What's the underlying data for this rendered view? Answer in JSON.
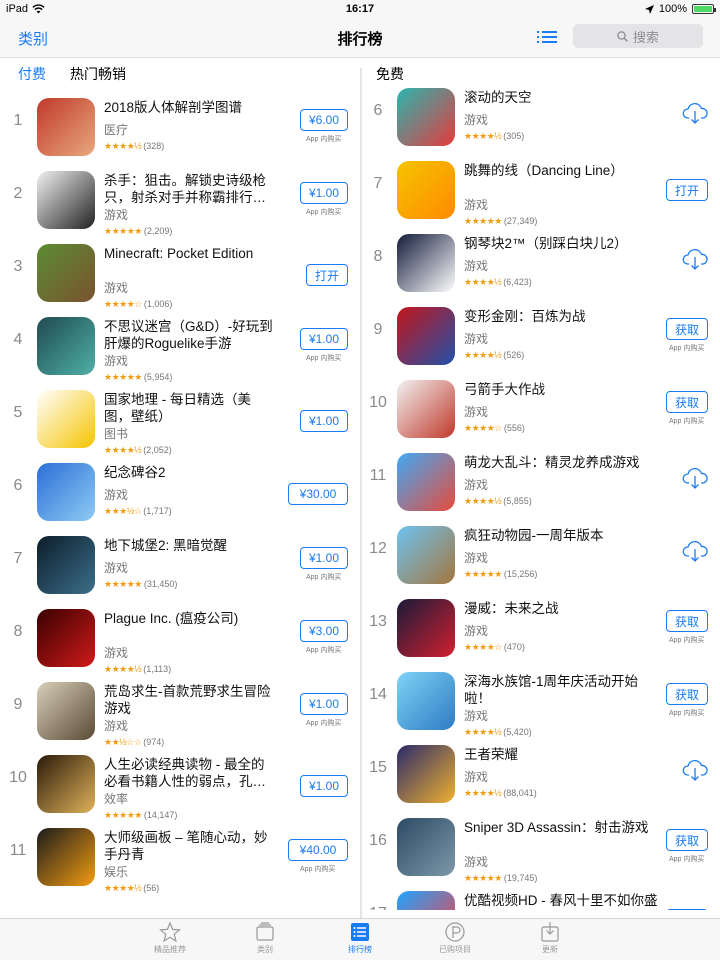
{
  "status": {
    "device": "iPad",
    "time": "16:17",
    "battery": "100%"
  },
  "nav": {
    "left": "类别",
    "title": "排行榜",
    "search_placeholder": "搜索"
  },
  "tabs": {
    "paid": "付费",
    "grossing": "热门畅销",
    "free": "免费"
  },
  "iap_label": "App 内购买",
  "paid": [
    {
      "rank": "1",
      "name": "2018版人体解剖学图谱",
      "category": "医疗",
      "stars": "★★★★½",
      "count": "(328)",
      "price": "¥6.00",
      "iap": true,
      "icon": "anatomy-icon",
      "colors": [
        "#c0392b",
        "#e8a87c"
      ]
    },
    {
      "rank": "2",
      "name": "杀手：狙击。解锁史诗级枪只，射杀对手并称霸排行…",
      "category": "游戏",
      "stars": "★★★★★",
      "count": "(2,209)",
      "price": "¥1.00",
      "iap": true,
      "icon": "hitman-icon",
      "colors": [
        "#f2f2f2",
        "#222222"
      ]
    },
    {
      "rank": "3",
      "name": "Minecraft: Pocket Edition",
      "category": "游戏",
      "stars": "★★★★☆",
      "count": "(1,006)",
      "price": "打开",
      "iap": false,
      "icon": "minecraft-icon",
      "colors": [
        "#5b8c32",
        "#7a5230"
      ]
    },
    {
      "rank": "4",
      "name": "不思议迷宫（G&D）-好玩到肝爆的Roguelike手游",
      "category": "游戏",
      "stars": "★★★★★",
      "count": "(5,954)",
      "price": "¥1.00",
      "iap": true,
      "icon": "maze-icon",
      "colors": [
        "#1f4a52",
        "#4fb0a6"
      ]
    },
    {
      "rank": "5",
      "name": "国家地理 - 每日精选（美图，壁纸）",
      "category": "图书",
      "stars": "★★★★½",
      "count": "(2,052)",
      "price": "¥1.00",
      "iap": false,
      "icon": "natgeo-icon",
      "colors": [
        "#ffffff",
        "#f5c400"
      ]
    },
    {
      "rank": "6",
      "name": "纪念碑谷2",
      "category": "游戏",
      "stars": "★★★½☆",
      "count": "(1,717)",
      "price": "¥30.00",
      "iap": false,
      "icon": "monument-valley-icon",
      "colors": [
        "#2b6fd6",
        "#8ecbf4"
      ]
    },
    {
      "rank": "7",
      "name": "地下城堡2: 黑暗觉醒",
      "category": "游戏",
      "stars": "★★★★★",
      "count": "(31,450)",
      "price": "¥1.00",
      "iap": true,
      "icon": "dungeon-icon",
      "colors": [
        "#0c1d2a",
        "#3c6f8a"
      ]
    },
    {
      "rank": "8",
      "name": "Plague Inc. (瘟疫公司)",
      "category": "游戏",
      "stars": "★★★★½",
      "count": "(1,113)",
      "price": "¥3.00",
      "iap": true,
      "icon": "plague-icon",
      "colors": [
        "#3a0000",
        "#d11a1a"
      ]
    },
    {
      "rank": "9",
      "name": "荒岛求生-首款荒野求生冒险游戏",
      "category": "游戏",
      "stars": "★★½☆☆",
      "count": "(974)",
      "price": "¥1.00",
      "iap": true,
      "icon": "survival-icon",
      "colors": [
        "#d8cfb8",
        "#5a4a35"
      ]
    },
    {
      "rank": "10",
      "name": "人生必读经典读物 - 最全的必看书籍人性的弱点，孔…",
      "category": "效率",
      "stars": "★★★★★",
      "count": "(14,147)",
      "price": "¥1.00",
      "iap": false,
      "icon": "book-icon",
      "colors": [
        "#2a1a0a",
        "#e0b35a"
      ]
    },
    {
      "rank": "11",
      "name": "大师级画板 – 笔随心动，妙手丹青",
      "category": "娱乐",
      "stars": "★★★★½",
      "count": "(56)",
      "price": "¥40.00",
      "iap": true,
      "icon": "procreate-icon",
      "colors": [
        "#1b1b1b",
        "#f39c12"
      ]
    }
  ],
  "free": [
    {
      "rank": "6",
      "name": "滚动的天空",
      "category": "游戏",
      "stars": "★★★★½",
      "count": "(305)",
      "action": "cloud",
      "icon": "rolling-sky-icon",
      "colors": [
        "#2bb5b0",
        "#e53b3b"
      ]
    },
    {
      "rank": "7",
      "name": "跳舞的线（Dancing Line）",
      "category": "游戏",
      "stars": "★★★★★",
      "count": "(27,349)",
      "action": "打开",
      "icon": "dancing-line-icon",
      "colors": [
        "#f5c400",
        "#ff8a00"
      ]
    },
    {
      "rank": "8",
      "name": "钢琴块2™（别踩白块儿2）",
      "category": "游戏",
      "stars": "★★★★½",
      "count": "(6,423)",
      "action": "cloud",
      "icon": "piano-tiles-icon",
      "colors": [
        "#111a3a",
        "#ffffff"
      ]
    },
    {
      "rank": "9",
      "name": "变形金刚：百炼为战",
      "category": "游戏",
      "stars": "★★★★½",
      "count": "(526)",
      "action": "获取",
      "iap": true,
      "icon": "transformers-icon",
      "colors": [
        "#c4161c",
        "#2050a8"
      ]
    },
    {
      "rank": "10",
      "name": "弓箭手大作战",
      "category": "游戏",
      "stars": "★★★★☆",
      "count": "(556)",
      "action": "获取",
      "iap": true,
      "icon": "archer-icon",
      "colors": [
        "#f2f2f2",
        "#c0392b"
      ]
    },
    {
      "rank": "11",
      "name": "萌龙大乱斗：精灵龙养成游戏",
      "category": "游戏",
      "stars": "★★★★½",
      "count": "(5,855)",
      "action": "cloud",
      "icon": "dragon-icon",
      "colors": [
        "#3fa9f5",
        "#e74c3c"
      ]
    },
    {
      "rank": "12",
      "name": "疯狂动物园-一周年版本",
      "category": "游戏",
      "stars": "★★★★★",
      "count": "(15,256)",
      "action": "cloud",
      "icon": "zoo-icon",
      "colors": [
        "#6fc3f0",
        "#a3763e"
      ]
    },
    {
      "rank": "13",
      "name": "漫威：未来之战",
      "category": "游戏",
      "stars": "★★★★☆",
      "count": "(470)",
      "action": "获取",
      "iap": true,
      "icon": "marvel-icon",
      "colors": [
        "#1a1a3a",
        "#d1202f"
      ]
    },
    {
      "rank": "14",
      "name": "深海水族馆-1周年庆活动开始啦！",
      "category": "游戏",
      "stars": "★★★★½",
      "count": "(5,420)",
      "action": "获取",
      "iap": true,
      "icon": "aquarium-icon",
      "colors": [
        "#7fd3f5",
        "#2e7bc4"
      ]
    },
    {
      "rank": "15",
      "name": "王者荣耀",
      "category": "游戏",
      "stars": "★★★★½",
      "count": "(88,041)",
      "action": "cloud",
      "icon": "honor-of-kings-icon",
      "colors": [
        "#2a2a6a",
        "#f0b030"
      ]
    },
    {
      "rank": "16",
      "name": "Sniper 3D Assassin：射击游戏",
      "category": "游戏",
      "stars": "★★★★★",
      "count": "(19,745)",
      "action": "获取",
      "iap": true,
      "icon": "sniper-icon",
      "colors": [
        "#2c4a63",
        "#7d98aa"
      ]
    },
    {
      "rank": "17",
      "name": "优酷视频HD - 春风十里不如你盛夏来袭",
      "category": "",
      "stars": "",
      "count": "",
      "action": "打开",
      "icon": "youku-icon",
      "colors": [
        "#1fa4ff",
        "#ff3d3d"
      ]
    }
  ],
  "tabbar": [
    {
      "label": "精品推荐",
      "icon": "star-icon",
      "active": false
    },
    {
      "label": "类别",
      "icon": "categories-icon",
      "active": false
    },
    {
      "label": "排行榜",
      "icon": "top-charts-icon",
      "active": true
    },
    {
      "label": "已购项目",
      "icon": "purchased-icon",
      "active": false
    },
    {
      "label": "更新",
      "icon": "updates-icon",
      "active": false
    }
  ],
  "colors": {
    "accent": "#1a7cf4",
    "star": "#f39c12"
  }
}
